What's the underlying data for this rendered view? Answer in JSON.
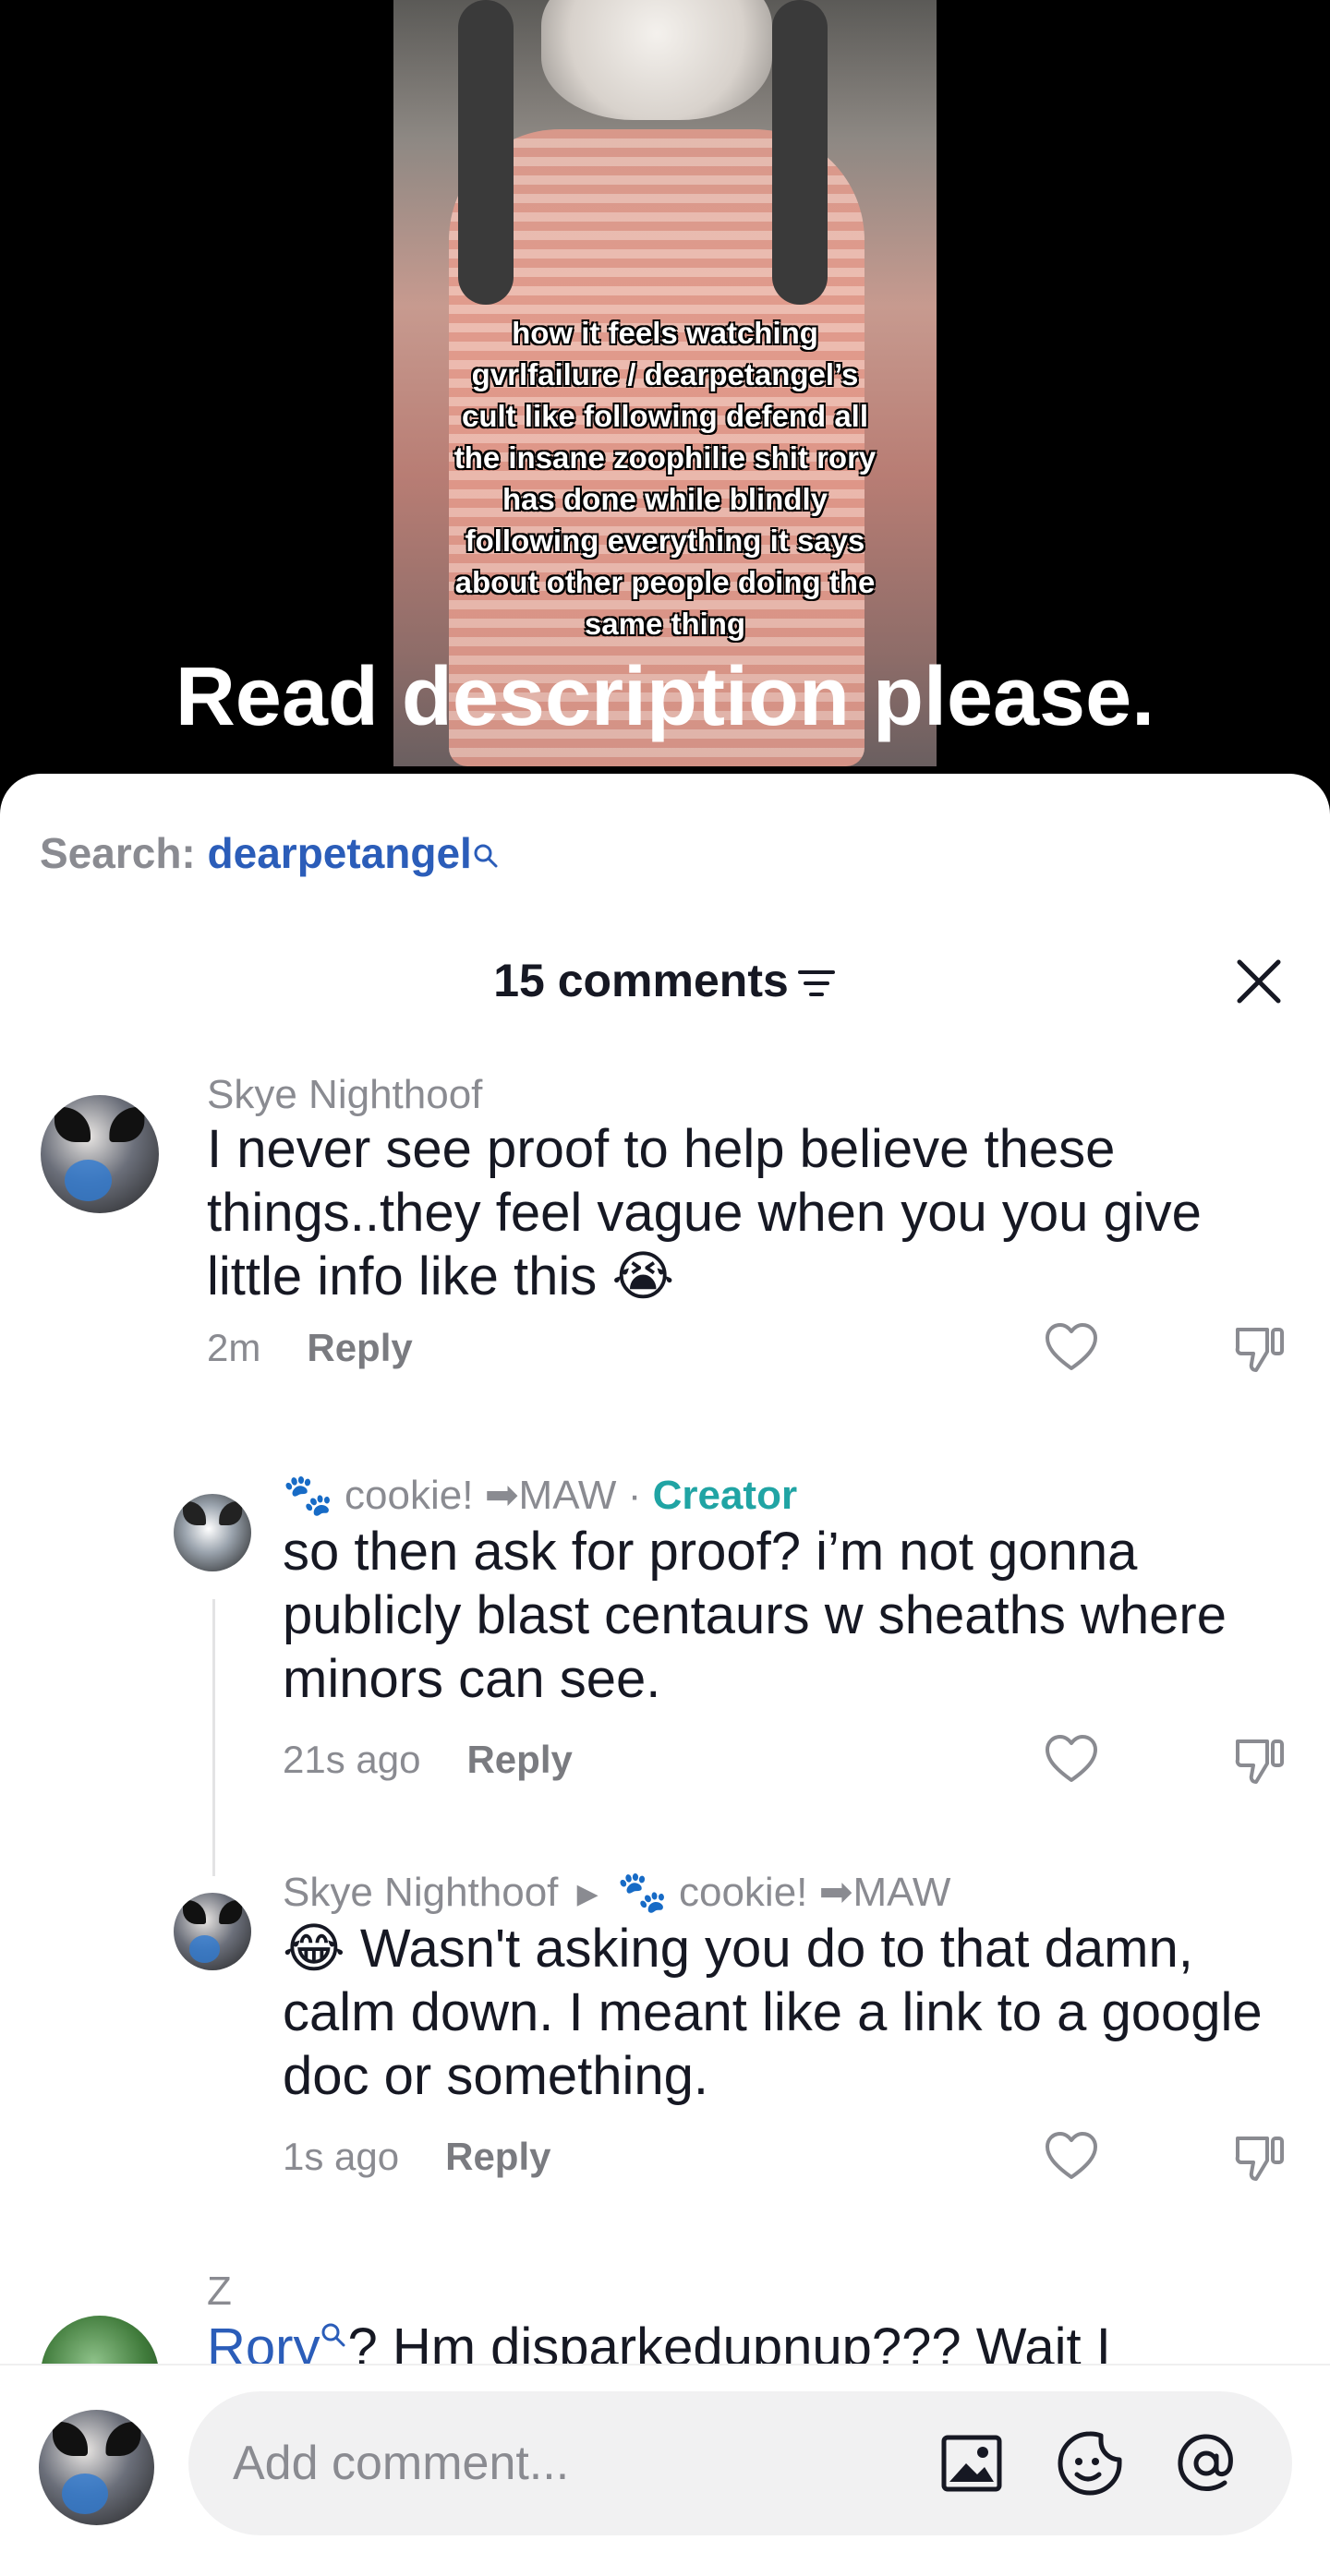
{
  "video": {
    "overlay_lines": [
      "how it feels watching",
      "gvrlfailure / dearpetangel’s",
      "cult like following defend all",
      "the insane zoophilie shit rory",
      "has done while blindly",
      "following everything it says",
      "about other people doing the",
      "same thing"
    ],
    "caption": "Read description please."
  },
  "search": {
    "label": "Search:",
    "term": "dearpetangel"
  },
  "header": {
    "title": "15 comments"
  },
  "comments": [
    {
      "username": "Skye Nighthoof",
      "text": "I never see proof to help believe these things..they feel vague when you you give little info like this 😭",
      "time": "2m",
      "reply_label": "Reply"
    },
    {
      "username_prefix": "🐾",
      "username": "cookie!",
      "username_suffix": "➡MAW",
      "creator_label": "Creator",
      "text": "so then ask for proof? i’m not gonna publicly blast centaurs w sheaths where minors can see.",
      "time": "21s ago",
      "reply_label": "Reply"
    },
    {
      "username": "Skye Nighthoof",
      "reply_to_prefix": "🐾",
      "reply_to": "cookie!",
      "reply_to_suffix": "➡MAW",
      "text": "😂 Wasn't asking you do to that damn, calm down. I meant like a link to a google doc or something.",
      "time": "1s ago",
      "reply_label": "Reply"
    },
    {
      "username": "Z",
      "text_link": "Rory",
      "text_rest": "? Hm disparkedupnup??? Wait I"
    }
  ],
  "composer": {
    "placeholder": "Add comment..."
  },
  "colors": {
    "link": "#2b5db9",
    "creator": "#20a4a4",
    "muted": "#8a8b91"
  }
}
